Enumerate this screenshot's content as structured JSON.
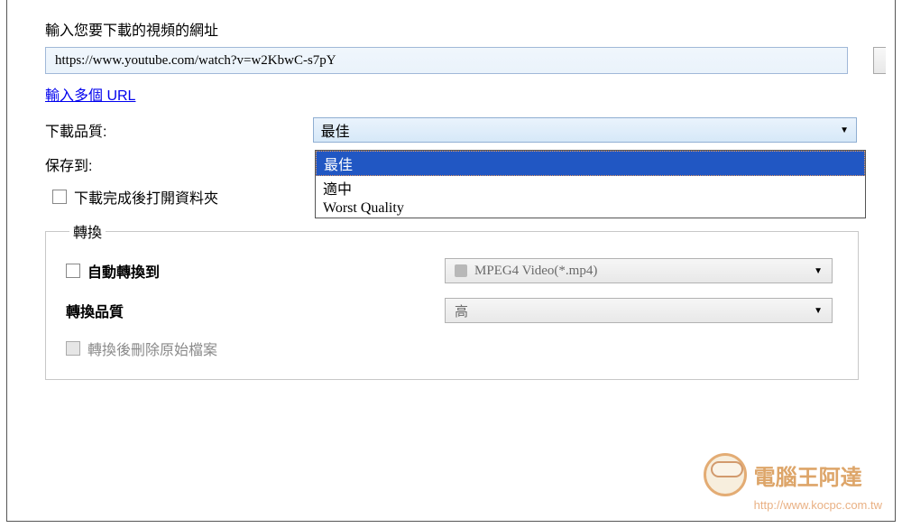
{
  "url_section": {
    "label": "輸入您要下載的視頻的網址",
    "value": "https://www.youtube.com/watch?v=w2KbwC-s7pY",
    "multiple_url_link": "輸入多個 URL"
  },
  "quality": {
    "label": "下載品質:",
    "selected": "最佳",
    "options": [
      "最佳",
      "適中",
      "Worst Quality"
    ]
  },
  "save_to": {
    "label": "保存到:"
  },
  "open_folder_checkbox": {
    "label": "下載完成後打開資料夾",
    "checked": false
  },
  "convert_group": {
    "legend": "轉換",
    "auto_convert": {
      "label": "自動轉換到",
      "checked": false
    },
    "format_select": {
      "value": "MPEG4 Video(*.mp4)"
    },
    "quality_label": "轉換品質",
    "quality_select": {
      "value": "高"
    },
    "delete_original": {
      "label": "轉換後刪除原始檔案",
      "disabled": true
    }
  },
  "watermark": {
    "text": "電腦王阿達",
    "url": "http://www.kocpc.com.tw"
  }
}
